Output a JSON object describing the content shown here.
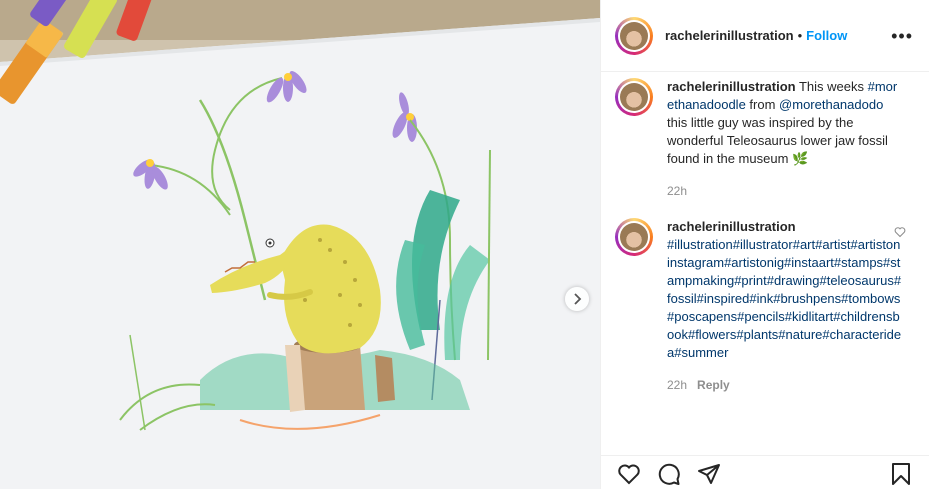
{
  "post": {
    "username": "rachelerinillustration",
    "separator": "•",
    "follow_label": "Follow",
    "more_label": "•••"
  },
  "caption": {
    "username": "rachelerinillustration",
    "text_1": " This weeks ",
    "tag_1": "#morethanadoodle",
    "text_2": " from ",
    "mention": "@morethanadodo",
    "text_3": " this little guy was inspired by the wonderful Teleosaurus lower jaw fossil found in the museum ",
    "emoji": "🌿",
    "time": "22h"
  },
  "comment": {
    "username": "rachelerinillustration",
    "hashtags": "#illustration#illustrator#art#artist#artistoninstagram#artistonig#instaart#stamps#stampmaking#print#drawing#teleosaurus#fossil#inspired#ink#brushpens#tombows#poscapens#pencils#kidlitart#childrensbook#flowers#plants#nature#characteridea#summer",
    "time": "22h",
    "reply_label": "Reply"
  },
  "icons": {
    "like": "heart-icon",
    "comment": "comment-icon",
    "share": "share-icon",
    "save": "bookmark-icon",
    "next": "chevron-right-icon",
    "comment_like": "small-heart-icon"
  }
}
